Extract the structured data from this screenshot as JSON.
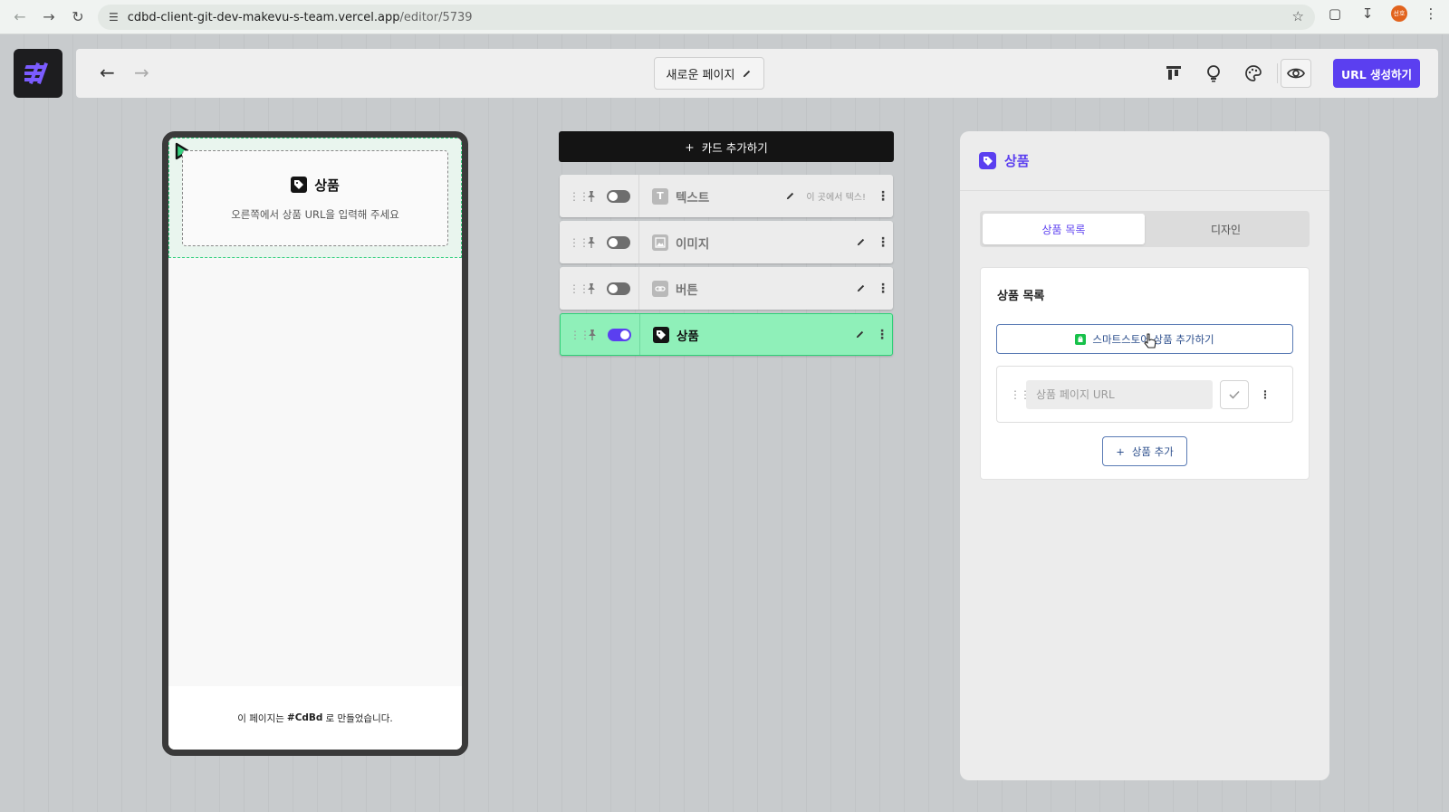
{
  "browser": {
    "url_host": "cdbd-client-git-dev-makevu-s-team.vercel.app",
    "url_path": "/editor/5739",
    "profile_initials": "선호"
  },
  "toolbar": {
    "page_title": "새로운 페이지",
    "generate_url_label": "URL 생성하기"
  },
  "preview": {
    "block_title": "상품",
    "block_hint": "오른쪽에서 상품 URL을 입력해 주세요",
    "footer_prefix": "이 페이지는",
    "footer_brand": "CdBd",
    "footer_suffix": "로 만들었습니다."
  },
  "cards": {
    "add_label": "카드 추가하기",
    "items": [
      {
        "label": "텍스트",
        "icon": "text-icon",
        "preview": "이 곳에서 텍스!",
        "visible": false
      },
      {
        "label": "이미지",
        "icon": "image-icon",
        "visible": false
      },
      {
        "label": "버튼",
        "icon": "link-icon",
        "visible": false
      },
      {
        "label": "상품",
        "icon": "tag-icon",
        "visible": true,
        "selected": true
      }
    ]
  },
  "panel": {
    "title": "상품",
    "tabs": [
      "상품 목록",
      "디자인"
    ],
    "active_tab": 0,
    "section_title": "상품 목록",
    "smartstore_label": "스마트스토어 상품 추가하기",
    "url_placeholder": "상품 페이지 URL",
    "add_product_label": "상품 추가"
  },
  "colors": {
    "accent": "#5b3ff0",
    "selected_card": "#8ff0b9",
    "selected_border": "#2fcf77",
    "smartstore_green": "#17c14a"
  }
}
